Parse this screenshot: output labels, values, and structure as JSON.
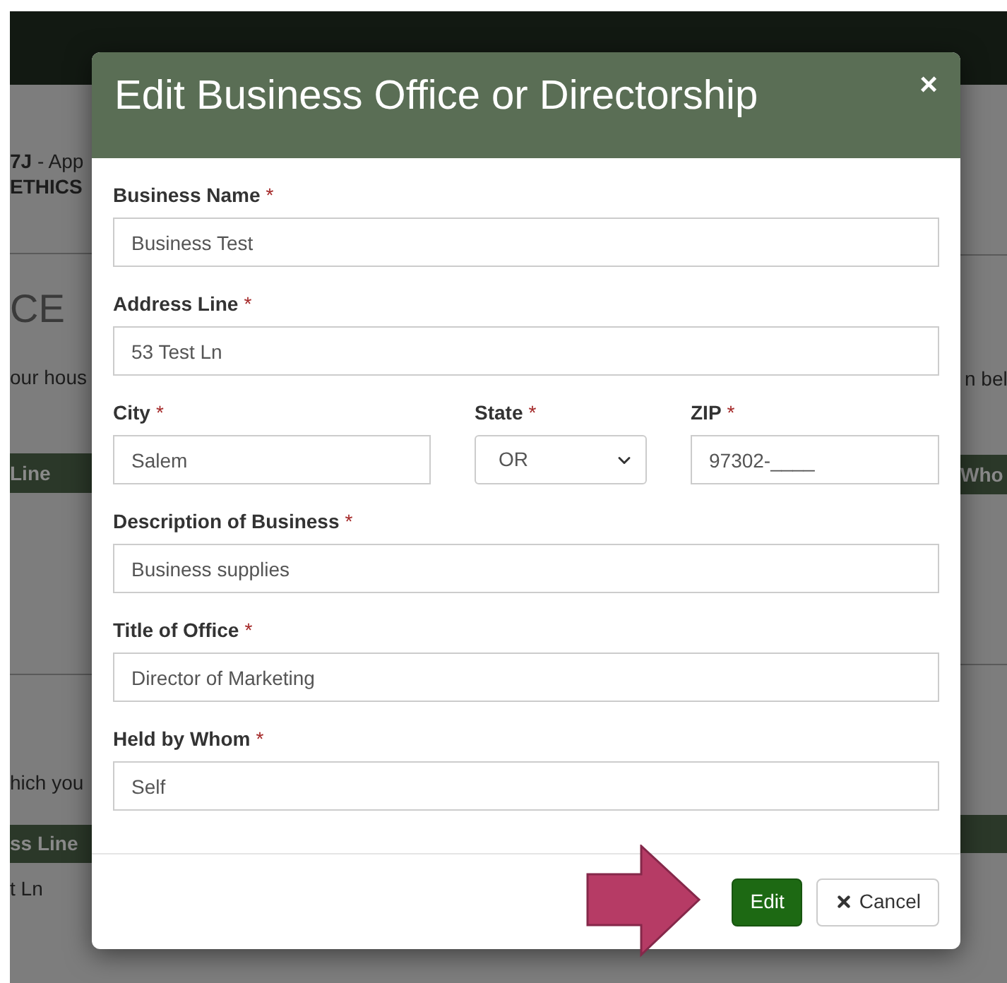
{
  "background": {
    "header_line": "**7J** - App",
    "subheader": "ETHICS",
    "heading": "CE",
    "intro_left": "our hous",
    "intro_right": "n bel",
    "table1": {
      "col_left": "Line",
      "col_right": "Who"
    },
    "section2_text": "hich you",
    "table2": {
      "col_left": "ss Line",
      "cell": "t Ln"
    }
  },
  "modal": {
    "title": "Edit Business Office or Directorship",
    "close": "×",
    "rows": [
      [
        {
          "kind": "text",
          "label": "Business Name",
          "required_mark": "*",
          "value": "Business Test"
        }
      ],
      [
        {
          "kind": "text",
          "label": "Address Line",
          "required_mark": "*",
          "value": "53 Test Ln"
        }
      ],
      [
        {
          "kind": "text",
          "label": "City",
          "required_mark": "*",
          "value": "Salem"
        },
        {
          "kind": "select",
          "label": "State",
          "required_mark": "*",
          "value": "OR"
        },
        {
          "kind": "text",
          "label": "ZIP",
          "required_mark": "*",
          "value": "97302-____"
        }
      ],
      [
        {
          "kind": "text",
          "label": "Description of Business",
          "required_mark": "*",
          "value": "Business supplies"
        }
      ],
      [
        {
          "kind": "text",
          "label": "Title of Office",
          "required_mark": "*",
          "value": "Director of Marketing"
        }
      ],
      [
        {
          "kind": "text",
          "label": "Held by Whom",
          "required_mark": "*",
          "value": "Self"
        }
      ]
    ],
    "buttons": [
      {
        "kind": "primary",
        "label": "Edit"
      },
      {
        "kind": "cancel",
        "label": "Cancel"
      }
    ]
  }
}
